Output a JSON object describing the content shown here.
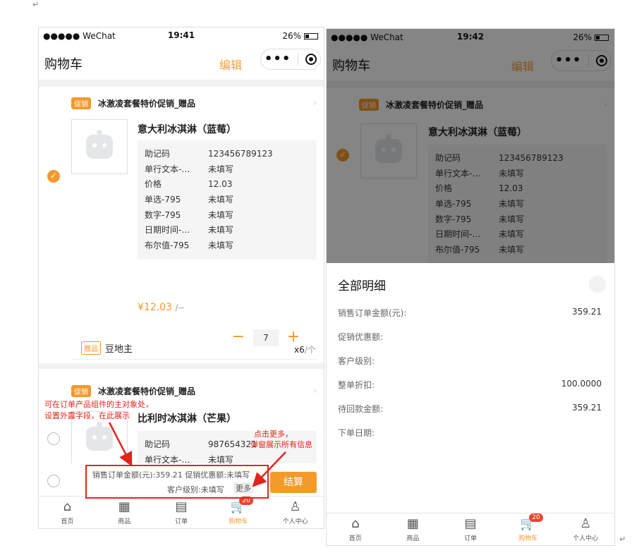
{
  "status_bar": {
    "carrier": "●●●●● WeChat",
    "battery": "26%"
  },
  "left": {
    "time": "19:41",
    "nav": {
      "title": "购物车",
      "edit": "编辑"
    },
    "group1": {
      "promo_tag": "促销",
      "promo_title": "冰激凌套餐特价促销_赠品",
      "product_name": "意大利冰淇淋（蓝莓）",
      "fields": [
        {
          "k": "助记码",
          "v": "123456789123"
        },
        {
          "k": "单行文本-…",
          "v": "未填写"
        },
        {
          "k": "价格",
          "v": "12.03"
        },
        {
          "k": "单选-795",
          "v": "未填写"
        },
        {
          "k": "数字-795",
          "v": "未填写"
        },
        {
          "k": "日期时间-…",
          "v": "未填写"
        },
        {
          "k": "布尔值-795",
          "v": "未填写"
        }
      ],
      "price": "¥12.03",
      "price_unit": "/--",
      "quantity": "7",
      "gift_tag": "赠品",
      "gift_name": "豆地主",
      "gift_qty": "x6",
      "gift_unit": "/个"
    },
    "group2": {
      "promo_tag": "促销",
      "promo_title": "冰激凌套餐特价促销_赠品",
      "product_name": "比利时冰淇淋（芒果）",
      "fields": [
        {
          "k": "助记码",
          "v": "987654321"
        },
        {
          "k": "单行文本-…",
          "v": "未填写"
        }
      ]
    },
    "footer": {
      "line1": "销售订单金额(元):359.21  促销优惠额:未填写",
      "line2": "客户级别:未填写",
      "more": "更多",
      "checkout": "结算"
    },
    "annotations": {
      "note1_line1": "可在订单产品组件的主对象处，",
      "note1_line2": "设置外露字段，在此展示",
      "note2_line1": "点击更多，",
      "note2_line2": "弹窗展示所有信息"
    }
  },
  "right": {
    "time": "19:42",
    "nav": {
      "title": "购物车",
      "edit": "编辑"
    },
    "group1": {
      "promo_tag": "促销",
      "promo_title": "冰激凌套餐特价促销_赠品",
      "product_name": "意大利冰淇淋（蓝莓）",
      "fields": [
        {
          "k": "助记码",
          "v": "123456789123"
        },
        {
          "k": "单行文本-…",
          "v": "未填写"
        },
        {
          "k": "价格",
          "v": "12.03"
        },
        {
          "k": "单选-795",
          "v": "未填写"
        },
        {
          "k": "数字-795",
          "v": "未填写"
        },
        {
          "k": "日期时间-…",
          "v": "未填写"
        },
        {
          "k": "布尔值-795",
          "v": "未填写"
        }
      ]
    },
    "sheet": {
      "title": "全部明细",
      "rows": [
        {
          "k": "销售订单金额(元):",
          "v": "359.21"
        },
        {
          "k": "促销优惠额:",
          "v": ""
        },
        {
          "k": "客户级别:",
          "v": ""
        },
        {
          "k": "整单折扣:",
          "v": "100.0000"
        },
        {
          "k": "待回款金额:",
          "v": "359.21"
        },
        {
          "k": "下单日期:",
          "v": ""
        }
      ]
    }
  },
  "tabbar": {
    "items": [
      {
        "label": "首页",
        "icon": "home-icon"
      },
      {
        "label": "商品",
        "icon": "grid-icon"
      },
      {
        "label": "订单",
        "icon": "order-icon"
      },
      {
        "label": "购物车",
        "icon": "cart-icon"
      },
      {
        "label": "个人中心",
        "icon": "user-icon"
      }
    ],
    "cart_badge": "20"
  },
  "colors": {
    "accent": "#f39a2b",
    "annotation": "#e1251b",
    "badge": "#e8452f"
  }
}
